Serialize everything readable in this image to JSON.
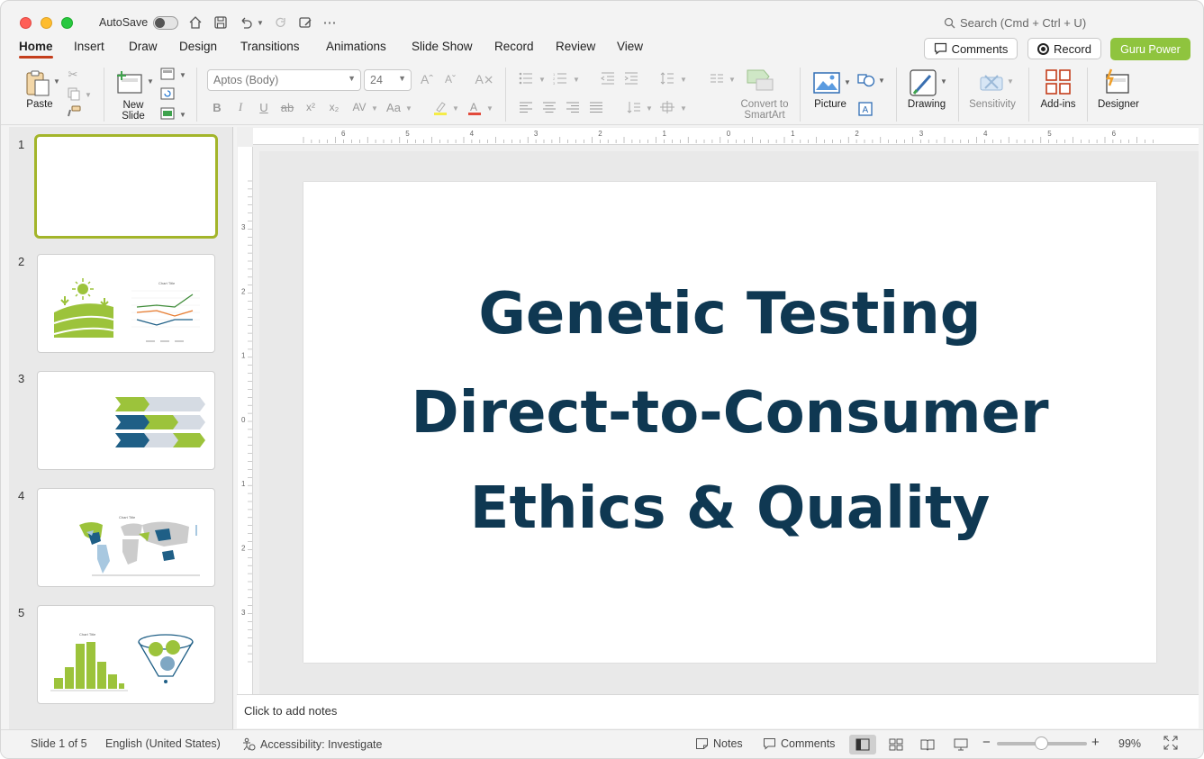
{
  "window": {
    "autosave_label": "AutoSave",
    "search_placeholder": "Search (Cmd + Ctrl + U)"
  },
  "tabs": [
    {
      "label": "Home",
      "active": true
    },
    {
      "label": "Insert"
    },
    {
      "label": "Draw"
    },
    {
      "label": "Design"
    },
    {
      "label": "Transitions"
    },
    {
      "label": "Animations"
    },
    {
      "label": "Slide Show"
    },
    {
      "label": "Record"
    },
    {
      "label": "Review"
    },
    {
      "label": "View"
    }
  ],
  "header_buttons": {
    "comments": "Comments",
    "record": "Record",
    "guru": "Guru Power",
    "guru_color": "#8fc43e"
  },
  "ribbon": {
    "paste": "Paste",
    "new_slide": "New\nSlide",
    "new_slide_line1": "New",
    "new_slide_line2": "Slide",
    "font_name": "Aptos (Body)",
    "font_size": "24",
    "convert_line1": "Convert to",
    "convert_line2": "SmartArt",
    "picture": "Picture",
    "drawing": "Drawing",
    "sensitivity": "Sensitivity",
    "addins": "Add-ins",
    "designer": "Designer"
  },
  "thumbnails": [
    {
      "num": "1",
      "active": true
    },
    {
      "num": "2"
    },
    {
      "num": "3"
    },
    {
      "num": "4"
    },
    {
      "num": "5"
    }
  ],
  "slide": {
    "line1": "Genetic Testing",
    "line2": "Direct-to-Consumer",
    "line3": "Ethics & Quality",
    "title_color": "#0f3852"
  },
  "notes_placeholder": "Click to add notes",
  "status": {
    "slide_count": "Slide 1 of 5",
    "language": "English (United States)",
    "accessibility": "Accessibility: Investigate",
    "notes": "Notes",
    "comments": "Comments",
    "zoom": "99%"
  },
  "ruler": {
    "h_ticks": [
      "6",
      "5",
      "4",
      "3",
      "2",
      "1",
      "0",
      "1",
      "2",
      "3",
      "4",
      "5",
      "6"
    ],
    "v_ticks": [
      "3",
      "2",
      "1",
      "0",
      "1",
      "2",
      "3"
    ]
  }
}
